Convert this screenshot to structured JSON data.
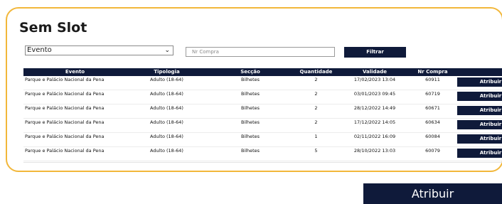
{
  "page": {
    "title": "Sem Slot"
  },
  "filters": {
    "evento_select": "Evento",
    "compra_placeholder": "Nr Compra",
    "filter_button": "Filtrar"
  },
  "table": {
    "headers": [
      "Evento",
      "Tipologia",
      "Secção",
      "Quantidade",
      "Validade",
      "Nr Compra",
      ""
    ],
    "rows": [
      {
        "evento": "Parque e Palácio Nacional da Pena",
        "tipologia": "Adulto (18-64)",
        "seccao": "Bilhetes",
        "quantidade": "2",
        "validade": "17/02/2023 13:04",
        "compra": "60911",
        "action": "Atribuir"
      },
      {
        "evento": "Parque e Palácio Nacional da Pena",
        "tipologia": "Adulto (18-64)",
        "seccao": "Bilhetes",
        "quantidade": "2",
        "validade": "03/01/2023 09:45",
        "compra": "60719",
        "action": "Atribuir"
      },
      {
        "evento": "Parque e Palácio Nacional da Pena",
        "tipologia": "Adulto (18-64)",
        "seccao": "Bilhetes",
        "quantidade": "2",
        "validade": "28/12/2022 14:49",
        "compra": "60671",
        "action": "Atribuir"
      },
      {
        "evento": "Parque e Palácio Nacional da Pena",
        "tipologia": "Adulto (18-64)",
        "seccao": "Bilhetes",
        "quantidade": "2",
        "validade": "17/12/2022 14:05",
        "compra": "60634",
        "action": "Atribuir"
      },
      {
        "evento": "Parque e Palácio Nacional da Pena",
        "tipologia": "Adulto (18-64)",
        "seccao": "Bilhetes",
        "quantidade": "1",
        "validade": "02/11/2022 16:09",
        "compra": "60084",
        "action": "Atribuir"
      },
      {
        "evento": "Parque e Palácio Nacional da Pena",
        "tipologia": "Adulto (18-64)",
        "seccao": "Bilhetes",
        "quantidade": "5",
        "validade": "28/10/2022 13:03",
        "compra": "60079",
        "action": "Atribuir"
      }
    ]
  },
  "bottom_button": "Atribuir",
  "colors": {
    "accent_border": "#f2b73a",
    "navy": "#0f1a3a"
  },
  "icons": {
    "select_arrow": "chevron-down-icon"
  }
}
